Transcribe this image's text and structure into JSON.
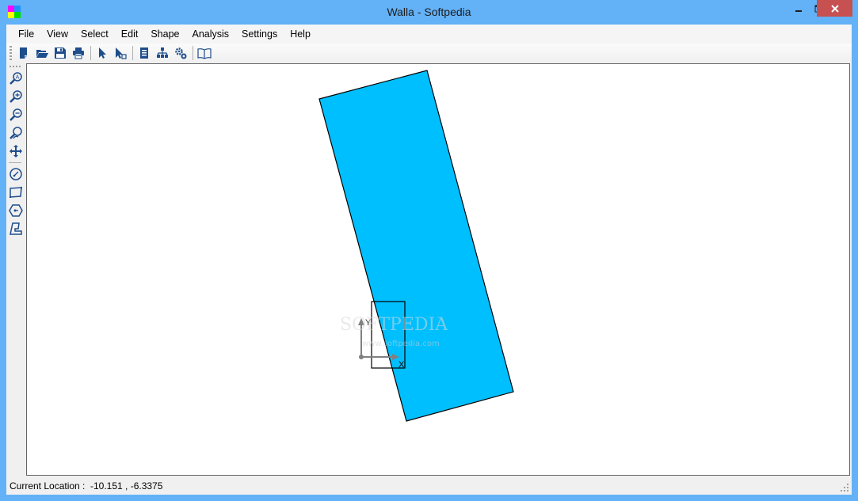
{
  "window": {
    "title": "Walla - Softpedia",
    "controls": {
      "minimize": "—",
      "maximize": "☐",
      "close": "✕"
    }
  },
  "menu": {
    "items": [
      "File",
      "View",
      "Select",
      "Edit",
      "Shape",
      "Analysis",
      "Settings",
      "Help"
    ]
  },
  "toolbar": {
    "buttons": [
      {
        "name": "new-icon",
        "tooltip": "New"
      },
      {
        "name": "open-folder-icon",
        "tooltip": "Open"
      },
      {
        "name": "save-icon",
        "tooltip": "Save"
      },
      {
        "name": "print-icon",
        "tooltip": "Print"
      },
      {
        "name": "select-pointer-icon",
        "tooltip": "Select"
      },
      {
        "name": "select-shape-icon",
        "tooltip": "Select Shape"
      },
      {
        "name": "document-properties-icon",
        "tooltip": "Properties"
      },
      {
        "name": "hierarchy-icon",
        "tooltip": "Hierarchy"
      },
      {
        "name": "settings-gears-icon",
        "tooltip": "Settings"
      },
      {
        "name": "book-icon",
        "tooltip": "Help"
      }
    ]
  },
  "left_toolbar": {
    "buttons": [
      {
        "name": "zoom-auto-icon"
      },
      {
        "name": "zoom-in-icon"
      },
      {
        "name": "zoom-out-icon"
      },
      {
        "name": "zoom-previous-icon"
      },
      {
        "name": "pan-icon"
      },
      {
        "name": "circle-tool-icon"
      },
      {
        "name": "rectangle-tool-icon"
      },
      {
        "name": "polygon-tool-icon"
      },
      {
        "name": "custom-shape-tool-icon"
      }
    ]
  },
  "canvas": {
    "shape_fill": "#00bfff",
    "shape_stroke": "#000000",
    "axis_color": "#808080",
    "axis_labels": {
      "x": "X",
      "y": "Y"
    },
    "watermark": {
      "main": "SOFTPEDIA",
      "tm": "™",
      "url": "www.softpedia.com"
    }
  },
  "status": {
    "label": "Current Location :",
    "value": "-10.151 , -6.3375"
  },
  "colors": {
    "titlebar": "#63b1f7",
    "close_button": "#c75050",
    "icon_blue": "#1e4d8c"
  }
}
